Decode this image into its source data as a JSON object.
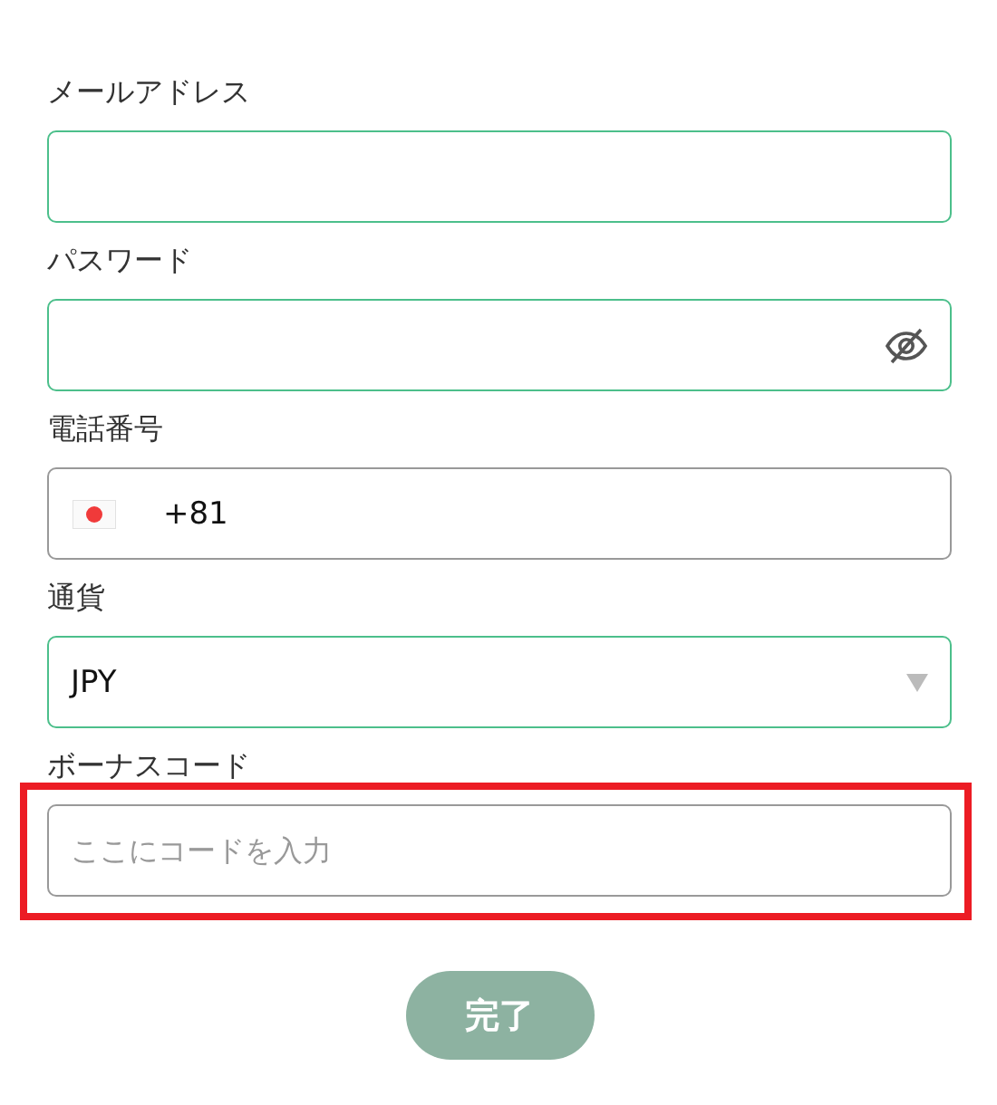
{
  "fields": [
    {
      "kind": "text",
      "label": "メールアドレス",
      "valid": true,
      "highlighted": false
    },
    {
      "kind": "password",
      "label": "パスワード",
      "valid": true,
      "highlighted": false
    },
    {
      "kind": "phone",
      "label": "電話番号",
      "value": "+81",
      "valid": false,
      "highlighted": false
    },
    {
      "kind": "select",
      "label": "通貨",
      "value": "JPY",
      "valid": true,
      "highlighted": false
    },
    {
      "kind": "text",
      "label": "ボーナスコード",
      "placeholder": "ここにコードを入力",
      "valid": false,
      "highlighted": true
    }
  ],
  "submit_button": "完了"
}
